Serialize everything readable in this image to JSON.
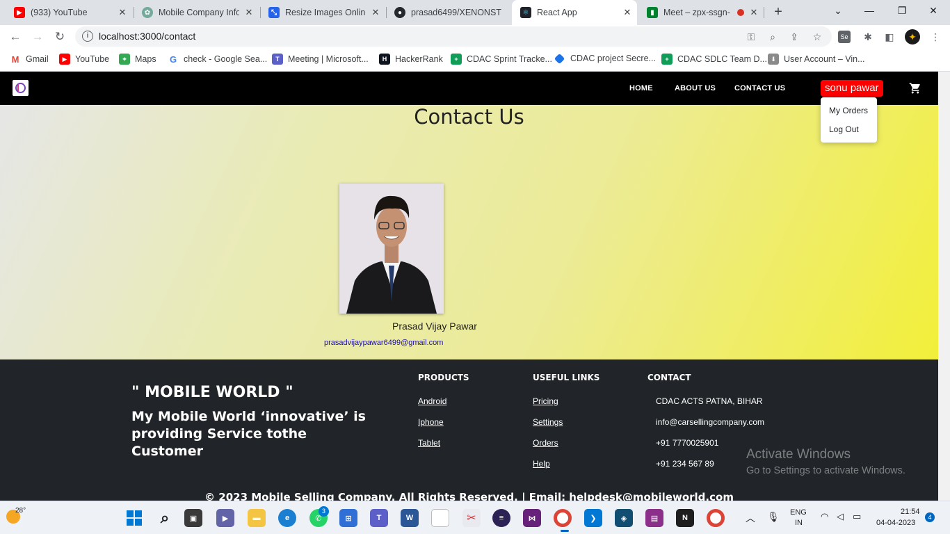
{
  "browser": {
    "tabs": [
      {
        "title": "(933) YouTube",
        "favicon": "youtube-icon",
        "color": "#ff0000"
      },
      {
        "title": "Mobile Company Infor",
        "favicon": "chatgpt-icon",
        "color": "#74aa9c"
      },
      {
        "title": "Resize Images Online",
        "favicon": "resize-icon",
        "color": "#2563eb"
      },
      {
        "title": "prasad6499/XENONST",
        "favicon": "github-icon",
        "color": "#24292f"
      },
      {
        "title": "React App",
        "favicon": "react-icon",
        "color": "#20232a",
        "active": true
      },
      {
        "title": "Meet – zpx-ssgn-",
        "favicon": "meet-icon",
        "color": "#00832d"
      }
    ],
    "url": "localhost:3000/contact",
    "bookmarks": [
      {
        "label": "Gmail",
        "icon": "gmail-icon",
        "color": "#ea4335"
      },
      {
        "label": "YouTube",
        "icon": "youtube-icon",
        "color": "#ff0000"
      },
      {
        "label": "Maps",
        "icon": "maps-icon",
        "color": "#34a853"
      },
      {
        "label": "check - Google Sea...",
        "icon": "google-icon",
        "color": "#4285f4"
      },
      {
        "label": "Meeting | Microsoft...",
        "icon": "teams-icon",
        "color": "#5b5fc7"
      },
      {
        "label": "HackerRank",
        "icon": "hackerrank-icon",
        "color": "#0e141e"
      },
      {
        "label": "CDAC Sprint Tracke...",
        "icon": "sheets-icon",
        "color": "#0f9d58"
      },
      {
        "label": "CDAC project Secre...",
        "icon": "diamond-icon",
        "color": "#1a73e8"
      },
      {
        "label": "CDAC SDLC Team D...",
        "icon": "sheets-icon",
        "color": "#0f9d58"
      },
      {
        "label": "User Account – Vin...",
        "icon": "account-icon",
        "color": "#8a8a8a"
      }
    ]
  },
  "site": {
    "nav": {
      "home": "HOME",
      "about": "ABOUT US",
      "contact": "CONTACT US"
    },
    "user": "sonu pawar",
    "dropdown": [
      "My Orders",
      "Log Out"
    ],
    "page_title": "Contact Us",
    "person": {
      "name": "Prasad Vijay Pawar",
      "email": "prasadvijaypawar6499@gmail.com"
    },
    "footer": {
      "brand": "\" MOBILE WORLD \"",
      "tagline": "My Mobile World ‘innovative’ is providing Service tothe Customer",
      "products_heading": "PRODUCTS",
      "products": [
        "Android",
        "Iphone",
        "Tablet"
      ],
      "links_heading": "USEFUL LINKS",
      "links": [
        "Pricing",
        "Settings",
        "Orders",
        "Help"
      ],
      "contact_heading": "CONTACT",
      "contact": [
        "CDAC ACTS PATNA, BIHAR",
        "info@carsellingcompany.com",
        "+91 7770025901",
        "+91 234 567 89"
      ],
      "copyright": "© 2023 Mobile Selling Company. All Rights Reserved. | Email: helpdesk@mobileworld.com"
    }
  },
  "windows": {
    "watermark_title": "Activate Windows",
    "watermark_sub": "Go to Settings to activate Windows.",
    "weather": "28°",
    "whatsapp_badge": "3",
    "lang": "ENG",
    "region": "IN",
    "time": "21:54",
    "date": "04-04-2023",
    "notification_count": "4"
  },
  "colors": {
    "user_badge": "#ff0000",
    "footer_bg": "#212529",
    "nav_bg": "#000000"
  }
}
